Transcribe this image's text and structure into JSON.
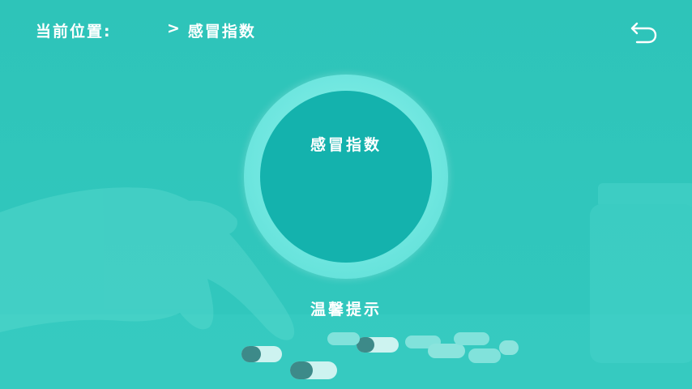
{
  "header": {
    "location_label": "当前位置:",
    "breadcrumb_separator": ">",
    "breadcrumb_current": "感冒指数"
  },
  "back_button": {
    "icon": "back-arrow-icon"
  },
  "dial": {
    "title": "感冒指数"
  },
  "tip_button": {
    "label": "温馨提示"
  },
  "colors": {
    "background": "#2fc2b8",
    "ring": "#6ee6df",
    "dial": "#14b2ad",
    "text": "#ffffff"
  }
}
